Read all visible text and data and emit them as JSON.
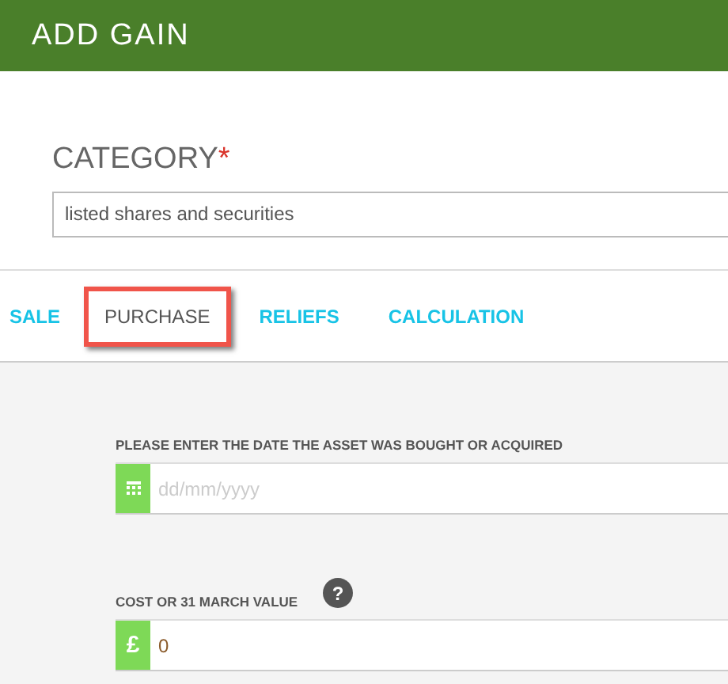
{
  "header": {
    "title": "ADD GAIN"
  },
  "category": {
    "label": "CATEGORY",
    "required_mark": "*",
    "value": "listed shares and securities"
  },
  "tabs": [
    {
      "label": "SALE",
      "selected": false,
      "highlighted": false
    },
    {
      "label": "PURCHASE",
      "selected": true,
      "highlighted": true
    },
    {
      "label": "RELIEFS",
      "selected": false,
      "highlighted": false
    },
    {
      "label": "CALCULATION",
      "selected": false,
      "highlighted": false
    }
  ],
  "fields": [
    {
      "kind": "date",
      "label": "PLEASE ENTER THE DATE THE ASSET WAS BOUGHT OR ACQUIRED",
      "placeholder": "dd/mm/yyyy"
    },
    {
      "kind": "currency",
      "label": "COST OR 31 MARCH VALUE",
      "prefix": "£",
      "value": "0",
      "help_text": "?"
    }
  ]
}
